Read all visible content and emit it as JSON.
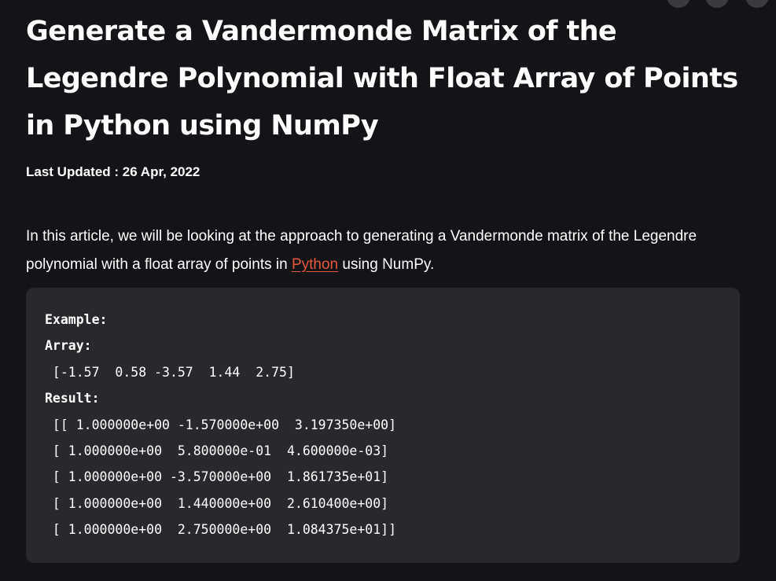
{
  "article": {
    "title": "Generate a Vandermonde Matrix of the Legendre Polynomial with Float Array of Points in Python using NumPy",
    "last_updated": "Last Updated : 26 Apr, 2022",
    "intro_before_link": "In this article, we will be looking at the approach to generating a Vandermonde matrix of the Legendre polynomial with a float array of points in ",
    "intro_link": "Python",
    "intro_after_link": " using NumPy."
  },
  "example": {
    "heading": "Example:",
    "array_label": "Array:",
    "array_value": " [-1.57  0.58 -3.57  1.44  2.75]",
    "result_label": "Result:",
    "result_rows": [
      " [[ 1.000000e+00 -1.570000e+00  3.197350e+00]",
      " [ 1.000000e+00  5.800000e-01  4.600000e-03]",
      " [ 1.000000e+00 -3.570000e+00  1.861735e+01]",
      " [ 1.000000e+00  1.440000e+00  2.610400e+00]",
      " [ 1.000000e+00  2.750000e+00  1.084375e+01]]"
    ]
  },
  "colors": {
    "background": "#131417",
    "code_background": "#28292c",
    "link": "#e8573b",
    "text": "#ffffff"
  }
}
